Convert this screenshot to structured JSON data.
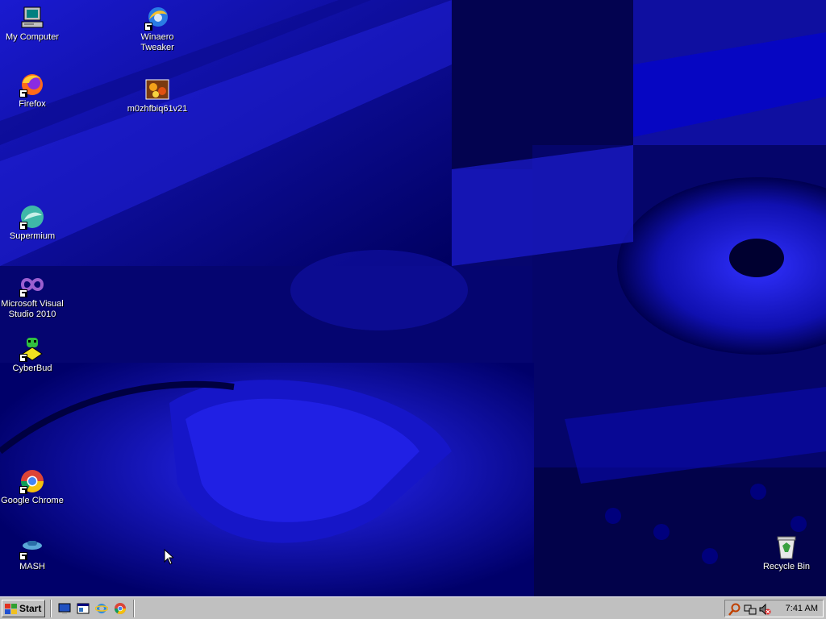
{
  "desktop": {
    "icons": [
      {
        "label": "My Computer",
        "icon": "my-computer-icon"
      },
      {
        "label": "Winaero\nTweaker",
        "icon": "winaero-tweaker-icon",
        "shortcut": true
      },
      {
        "label": "Firefox",
        "icon": "firefox-icon",
        "shortcut": true
      },
      {
        "label": "m0zhfbiq61v21",
        "icon": "image-file-icon"
      },
      {
        "label": "Supermium",
        "icon": "supermium-icon",
        "shortcut": true
      },
      {
        "label": "Microsoft Visual\nStudio 2010",
        "icon": "visual-studio-icon",
        "shortcut": true
      },
      {
        "label": "CyberBud",
        "icon": "cyberbud-icon",
        "shortcut": true
      },
      {
        "label": "Google Chrome",
        "icon": "chrome-icon",
        "shortcut": true
      },
      {
        "label": "MASH",
        "icon": "mash-icon",
        "shortcut": true
      },
      {
        "label": "Recycle Bin",
        "icon": "recycle-bin-icon"
      }
    ]
  },
  "taskbar": {
    "start_label": "Start",
    "quick_launch": [
      "show-desktop-icon",
      "explorer-icon",
      "internet-explorer-icon",
      "chrome-icon"
    ],
    "tray_icons": [
      "search-icon",
      "network-icon",
      "volume-muted-icon"
    ],
    "clock": "7:41 AM"
  },
  "colors": {
    "desktop_blue": "#0a0a8c",
    "taskbar_gray": "#c0c0c0",
    "label_text": "#ffffff"
  }
}
